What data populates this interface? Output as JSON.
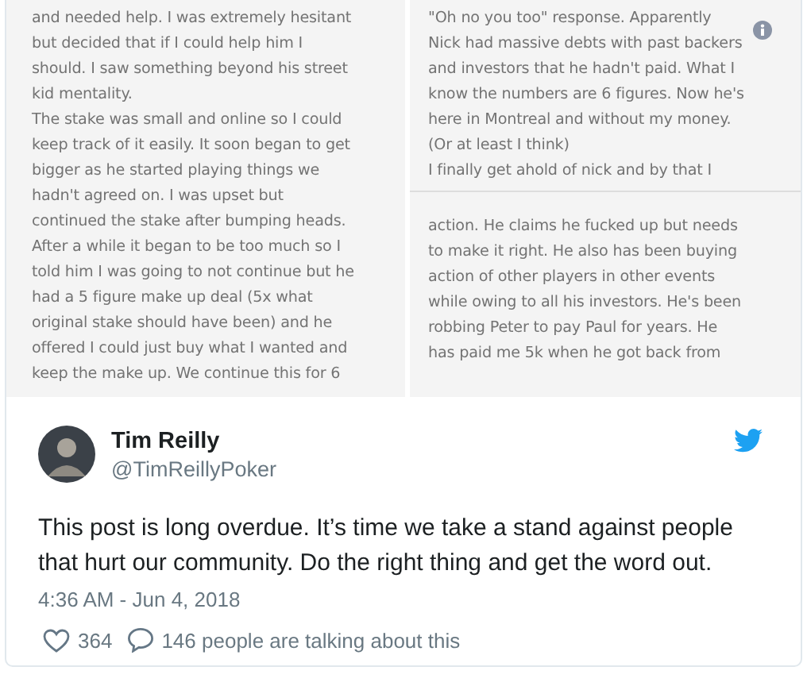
{
  "media": {
    "left_page": {
      "lines": [
        "and needed help. I was extremely hesitant",
        "but decided that if I could help him I",
        "should. I saw something beyond his street",
        "kid mentality.",
        "The stake was small and online so I could",
        "keep track of it easily. It soon began to get",
        "bigger as he started playing things we",
        "hadn't agreed on. I was upset but",
        "continued the stake after bumping heads.",
        "After a while it began to be too much so I",
        "told him I was going to not continue but he",
        "had a 5 figure make up deal (5x what",
        "original stake should have been) and he",
        "offered I could just buy what I wanted and",
        "keep the make up. We continue this for 6"
      ]
    },
    "right_page": {
      "upper_lines": [
        "\"Oh no you too\" response. Apparently",
        "Nick had massive debts with past backers",
        "and investors that he hadn't paid. What I",
        "know the numbers are 6 figures. Now he's",
        "here in Montreal and without my money.",
        "(Or at least I think)",
        "I finally get ahold of nick and by that I"
      ],
      "lower_lines": [
        "action. He claims he fucked up but needs",
        "to make it right. He also has been buying",
        "action of other players in other events",
        "while owing to all his investors. He's been",
        "robbing Peter to pay Paul for years. He",
        "has paid me 5k when he got back from"
      ]
    }
  },
  "tweet": {
    "author": {
      "name": "Tim Reilly",
      "handle": "@TimReillyPoker"
    },
    "text": "This post is long overdue. It’s time we take a stand against people that hurt our community. Do the right thing and get the word out.",
    "timestamp": "4:36 AM - Jun 4, 2018",
    "likes": "364",
    "conversation": "146 people are talking about this"
  }
}
